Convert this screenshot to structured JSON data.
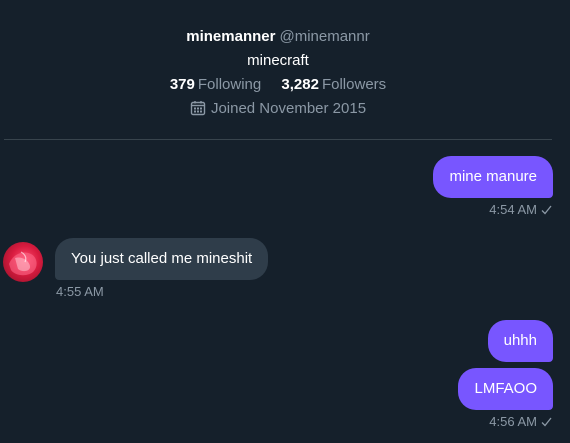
{
  "profile": {
    "display_name": "minemanner",
    "handle": "@minemannr",
    "bio": "minecraft",
    "following_count": "379",
    "following_label": "Following",
    "followers_count": "3,282",
    "followers_label": "Followers",
    "joined": "Joined November 2015"
  },
  "messages": [
    {
      "direction": "outgoing",
      "text": "mine manure",
      "time": "4:54 AM"
    },
    {
      "direction": "incoming",
      "text": "You just called me mineshit",
      "time": "4:55 AM"
    },
    {
      "direction": "outgoing",
      "text": "uhhh"
    },
    {
      "direction": "outgoing",
      "text": "LMFAOO",
      "time": "4:56 AM"
    }
  ],
  "colors": {
    "background": "#15202b",
    "outgoing_bubble": "#7856ff",
    "incoming_bubble": "#2f3d4a",
    "muted_text": "#8b98a5",
    "divider": "#38444d"
  },
  "icons": {
    "joined": "calendar-icon",
    "read_receipt": "check-icon"
  }
}
